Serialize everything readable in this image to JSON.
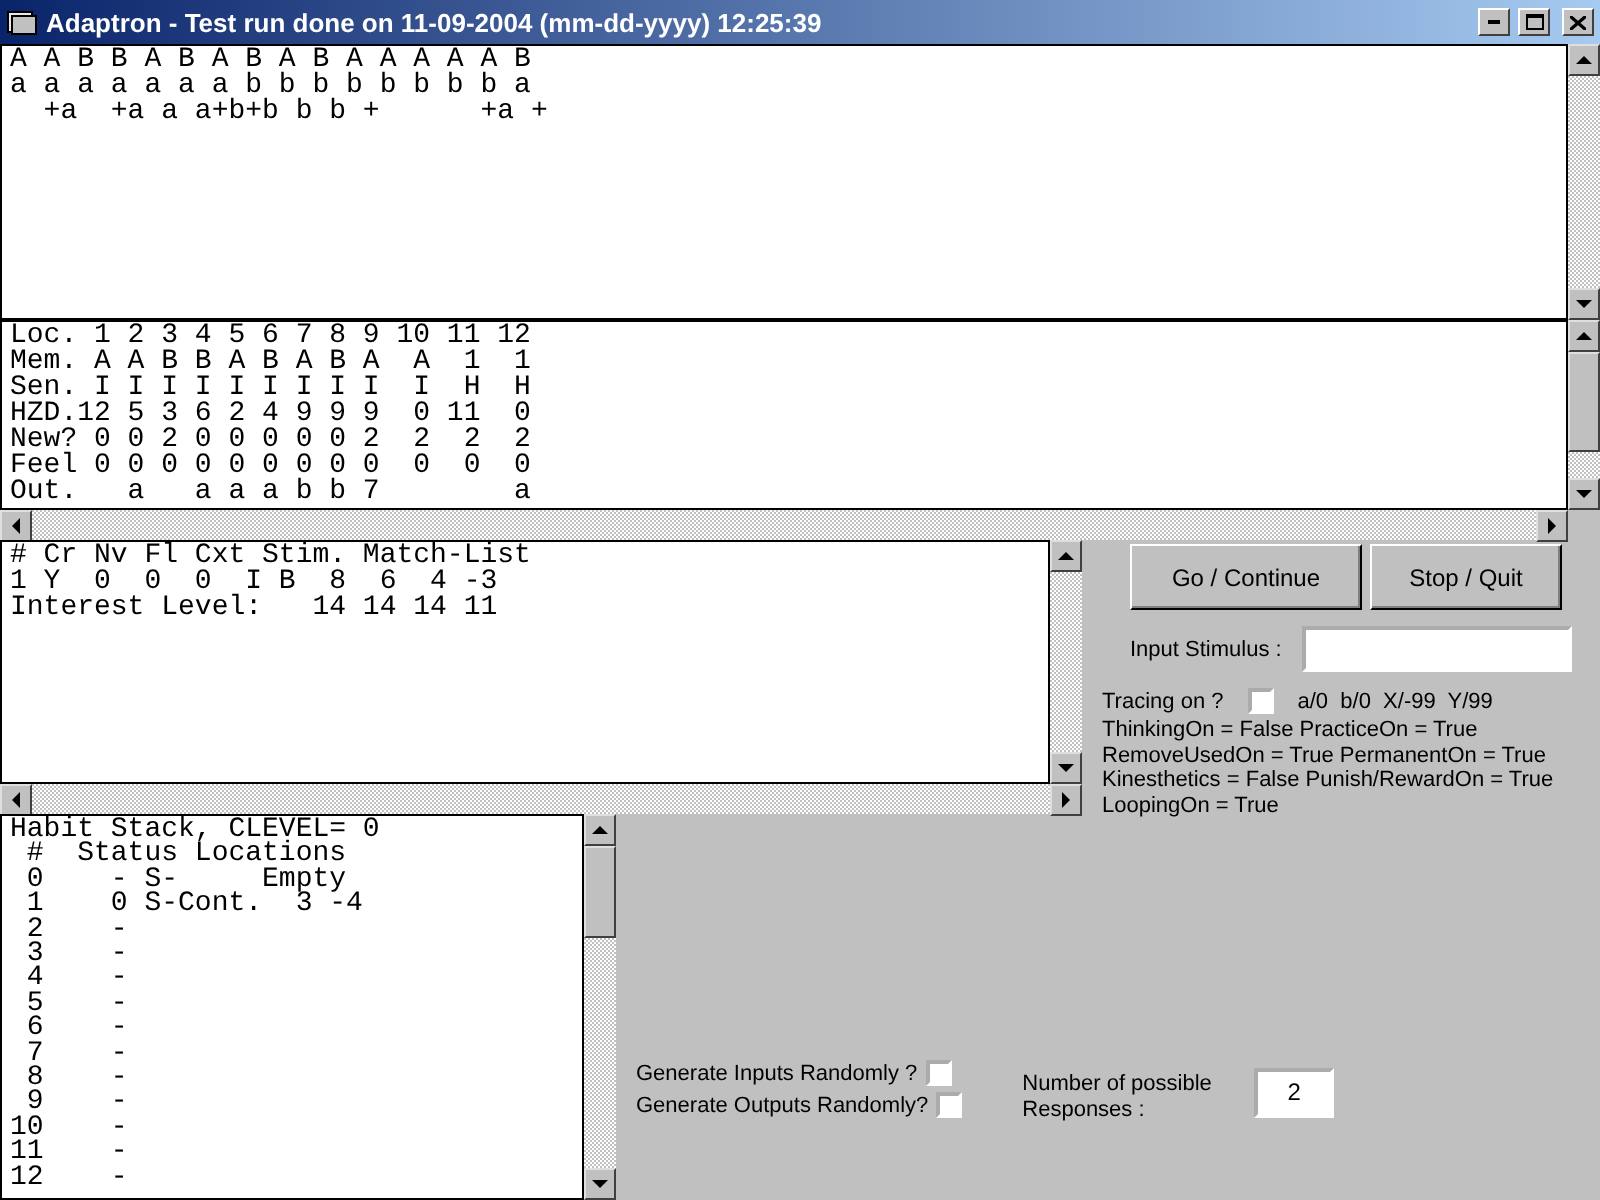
{
  "window": {
    "title": "Adaptron - Test run done on 11-09-2004 (mm-dd-yyyy) 12:25:39"
  },
  "sequence_pane": {
    "lines": [
      "A A B B A B A B A B A A A A A B",
      "a a a a a a a b b b b b b b b a",
      "  +a  +a a a+b+b b b +      +a +"
    ]
  },
  "memory_table": {
    "lines": [
      "Loc. 1 2 3 4 5 6 7 8 9 10 11 12",
      "Mem. A A B B A B A B A  A  1  1",
      "Sen. I I I I I I I I I  I  H  H",
      "HZD.12 5 3 6 2 4 9 9 9  0 11  0",
      "New? 0 0 2 0 0 0 0 0 2  2  2  2",
      "Feel 0 0 0 0 0 0 0 0 0  0  0  0",
      "Out.   a   a a a b b 7        a"
    ]
  },
  "match_pane": {
    "lines": [
      "# Cr Nv Fl Cxt Stim. Match-List",
      "1 Y  0  0  0  I B  8  6  4 -3",
      "Interest Level:   14 14 14 11"
    ]
  },
  "buttons": [
    {
      "label": "Go / Continue"
    },
    {
      "label": "Stop / Quit"
    }
  ],
  "input_stimulus": {
    "label": "Input Stimulus :"
  },
  "tracing": {
    "label": "Tracing on ?",
    "checked": false,
    "legend": "a/0  b/0  X/-99  Y/99"
  },
  "settings": [
    "ThinkingOn = False PracticeOn = True",
    "RemoveUsedOn = True PermanentOn = True",
    "Kinesthetics = False Punish/RewardOn = True",
    "LoopingOn = True"
  ],
  "habit_stack": {
    "lines": [
      "Habit Stack, CLEVEL= 0",
      " #  Status Locations",
      " 0    - S-     Empty",
      " 1    0 S-Cont.  3 -4",
      " 2    -",
      " 3    -",
      " 4    -",
      " 5    -",
      " 6    -",
      " 7    -",
      " 8    -",
      " 9    -",
      "10    -",
      "11    -",
      "12    -"
    ]
  },
  "random_options": [
    {
      "label": "Generate Inputs Randomly ?",
      "checked": false
    },
    {
      "label": "Generate Outputs Randomly?",
      "checked": false
    }
  ],
  "responses": {
    "label": "Number of possible Responses :",
    "value": "2"
  }
}
